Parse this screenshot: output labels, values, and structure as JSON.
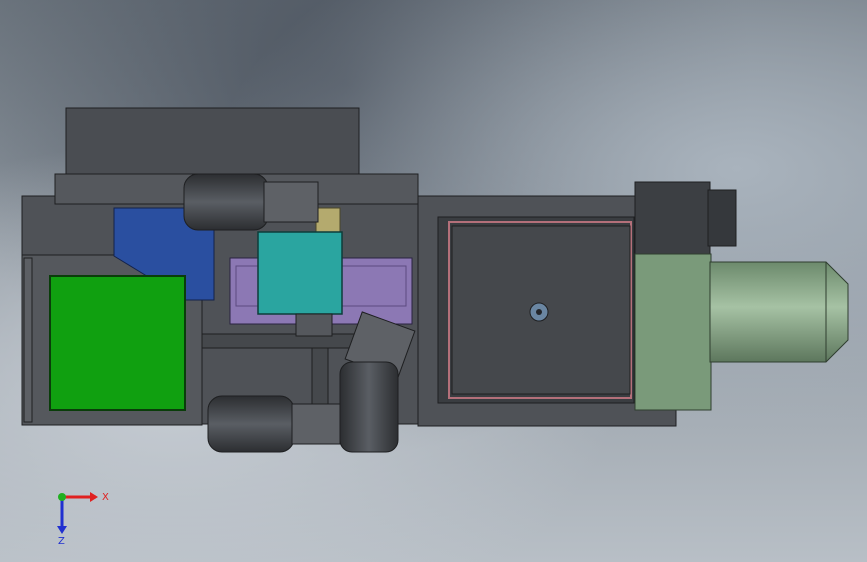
{
  "axis_triad": {
    "x_label": "X",
    "z_label": "Z",
    "x_color": "#e02020",
    "y_color": "#20b020",
    "z_color": "#2030d0"
  },
  "colors": {
    "background": "#8c959e",
    "frame": "#4a4d52",
    "motor": "#3f4247",
    "green_panel": "#10a010",
    "blue_fan": "#2a4fa0",
    "teal_box": "#2aa5a0",
    "purple_plate": "#8c78b4",
    "green_cylinder": "#7a9a7a",
    "tan_part": "#b4aa6e"
  }
}
